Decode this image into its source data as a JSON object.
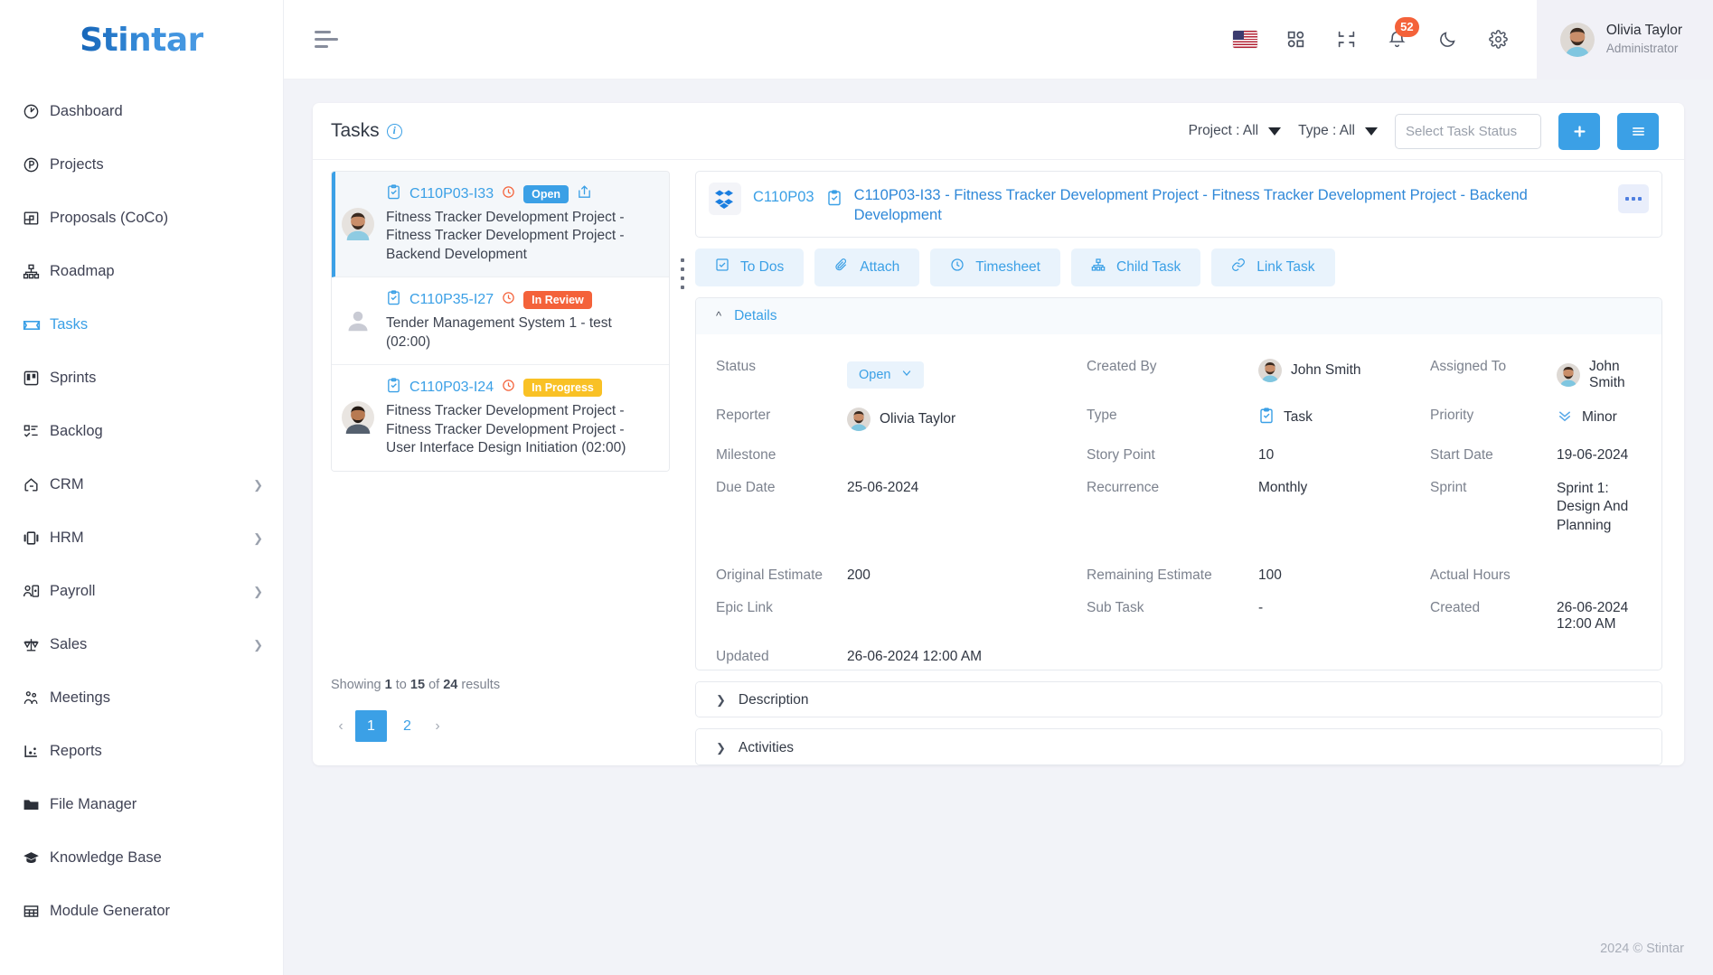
{
  "brand": {
    "name": "Stintar"
  },
  "sidebar": {
    "items": [
      {
        "label": "Dashboard",
        "icon": "gauge-icon",
        "active": false,
        "caret": false
      },
      {
        "label": "Projects",
        "icon": "projects-icon",
        "active": false,
        "caret": false
      },
      {
        "label": "Proposals (CoCo)",
        "icon": "proposals-icon",
        "active": false,
        "caret": false
      },
      {
        "label": "Roadmap",
        "icon": "roadmap-icon",
        "active": false,
        "caret": false
      },
      {
        "label": "Tasks",
        "icon": "tasks-icon",
        "active": true,
        "caret": false
      },
      {
        "label": "Sprints",
        "icon": "sprints-icon",
        "active": false,
        "caret": false
      },
      {
        "label": "Backlog",
        "icon": "backlog-icon",
        "active": false,
        "caret": false
      },
      {
        "label": "CRM",
        "icon": "crm-icon",
        "active": false,
        "caret": true
      },
      {
        "label": "HRM",
        "icon": "hrm-icon",
        "active": false,
        "caret": true
      },
      {
        "label": "Payroll",
        "icon": "payroll-icon",
        "active": false,
        "caret": true
      },
      {
        "label": "Sales",
        "icon": "sales-icon",
        "active": false,
        "caret": true
      },
      {
        "label": "Meetings",
        "icon": "meetings-icon",
        "active": false,
        "caret": false
      },
      {
        "label": "Reports",
        "icon": "reports-icon",
        "active": false,
        "caret": false
      },
      {
        "label": "File Manager",
        "icon": "folder-icon",
        "active": false,
        "caret": false
      },
      {
        "label": "Knowledge Base",
        "icon": "graduation-cap-icon",
        "active": false,
        "caret": false
      },
      {
        "label": "Module Generator",
        "icon": "grid-table-icon",
        "active": false,
        "caret": false
      }
    ]
  },
  "topbar": {
    "menu_toggle": "hamburger-icon",
    "language_flag": "us-flag-icon",
    "apps": "apps-grid-icon",
    "fullscreen": "collapse-screen-icon",
    "notifications_count": "52",
    "dark_mode": "moon-icon",
    "settings": "gear-icon",
    "user": {
      "name": "Olivia Taylor",
      "role": "Administrator"
    }
  },
  "page": {
    "title": "Tasks",
    "filters": {
      "project": "Project : All",
      "type": "Type : All"
    },
    "status_search": {
      "value": "",
      "placeholder": "Select Task Status"
    },
    "add_button": "+",
    "list_button": "≡"
  },
  "task_list": {
    "items": [
      {
        "key": "C110P03-I33",
        "status": "Open",
        "status_kind": "open",
        "title": "Fitness Tracker Development Project - Fitness Tracker Development Project - Backend Development",
        "selected": true,
        "has_avatar": true,
        "has_share": true
      },
      {
        "key": "C110P35-I27",
        "status": "In Review",
        "status_kind": "review",
        "title": "Tender Management System 1 - test (02:00)",
        "selected": false,
        "has_avatar": false,
        "has_share": false
      },
      {
        "key": "C110P03-I24",
        "status": "In Progress",
        "status_kind": "progress",
        "title": "Fitness Tracker Development Project - Fitness Tracker Development Project - User Interface Design Initiation (02:00)",
        "selected": false,
        "has_avatar": true,
        "has_share": false
      }
    ],
    "showing_prefix": "Showing",
    "showing_from": "1",
    "showing_mid": "to",
    "showing_to": "15",
    "showing_of": "of",
    "showing_total": "24",
    "showing_suffix": "results",
    "pagination": {
      "prev": "‹",
      "pages": [
        "1",
        "2"
      ],
      "current": "1",
      "next": "›"
    }
  },
  "detail": {
    "project_code": "C110P03",
    "title": "C110P03-I33 - Fitness Tracker Development Project - Fitness Tracker Development Project - Backend Development",
    "more": "more-options",
    "tabs": [
      {
        "label": "To Dos",
        "icon": "checkbox-icon"
      },
      {
        "label": "Attach",
        "icon": "paperclip-icon"
      },
      {
        "label": "Timesheet",
        "icon": "clock-icon"
      },
      {
        "label": "Child Task",
        "icon": "hierarchy-icon"
      },
      {
        "label": "Link Task",
        "icon": "link-icon"
      }
    ],
    "details_panel": {
      "title": "Details",
      "expanded": true
    },
    "fields": {
      "status_label": "Status",
      "status_value": "Open",
      "created_by_label": "Created By",
      "created_by_value": "John Smith",
      "assigned_to_label": "Assigned To",
      "assigned_to_value": "John Smith",
      "reporter_label": "Reporter",
      "reporter_value": "Olivia Taylor",
      "type_label": "Type",
      "type_value": "Task",
      "priority_label": "Priority",
      "priority_value": "Minor",
      "milestone_label": "Milestone",
      "milestone_value": "",
      "story_point_label": "Story Point",
      "story_point_value": "10",
      "start_date_label": "Start Date",
      "start_date_value": "19-06-2024",
      "due_date_label": "Due Date",
      "due_date_value": "25-06-2024",
      "recurrence_label": "Recurrence",
      "recurrence_value": "Monthly",
      "sprint_label": "Sprint",
      "sprint_value": "Sprint 1: Design And Planning",
      "original_estimate_label": "Original Estimate",
      "original_estimate_value": "200",
      "remaining_estimate_label": "Remaining Estimate",
      "remaining_estimate_value": "100",
      "actual_hours_label": "Actual Hours",
      "actual_hours_value": "",
      "epic_link_label": "Epic Link",
      "epic_link_value": "",
      "sub_task_label": "Sub Task",
      "sub_task_value": "-",
      "created_label": "Created",
      "created_value": "26-06-2024 12:00 AM",
      "updated_label": "Updated",
      "updated_value": "26-06-2024 12:00 AM"
    },
    "description_panel": {
      "title": "Description"
    },
    "activities_panel": {
      "title": "Activities"
    }
  },
  "footer": {
    "copyright": "2024 © Stintar"
  },
  "colors": {
    "accent": "#3ba0e6",
    "danger": "#f4623a",
    "warning": "#f9c125",
    "link": "#2f88d8",
    "page_bg": "#f2f3f8"
  }
}
